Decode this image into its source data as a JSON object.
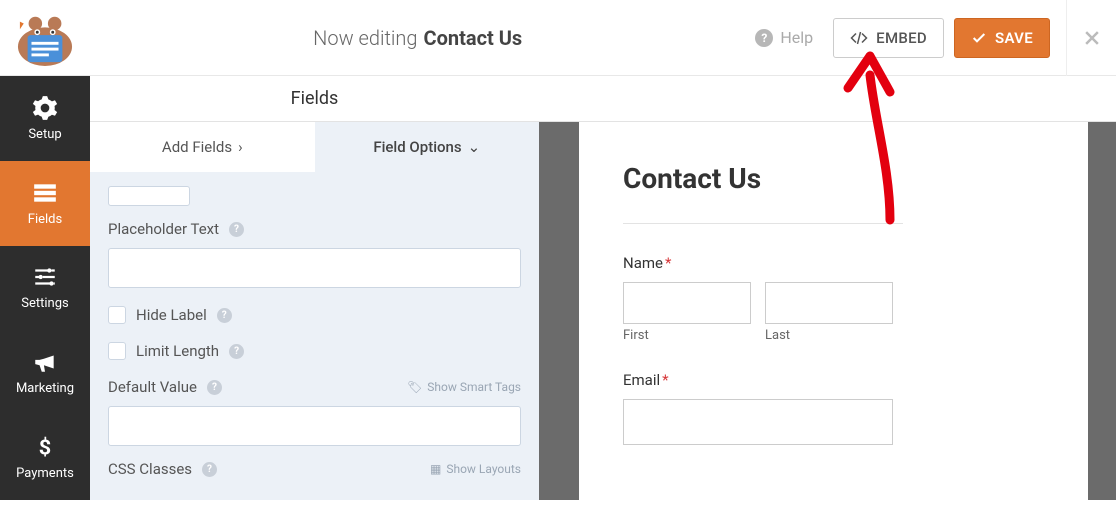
{
  "topbar": {
    "editing_prefix": "Now editing",
    "form_name": "Contact Us",
    "help": "Help",
    "embed": "EMBED",
    "save": "SAVE"
  },
  "sidebar": {
    "items": [
      {
        "label": "Setup"
      },
      {
        "label": "Fields"
      },
      {
        "label": "Settings"
      },
      {
        "label": "Marketing"
      },
      {
        "label": "Payments"
      }
    ]
  },
  "panel": {
    "title": "Fields",
    "tabs": {
      "add": "Add Fields",
      "options": "Field Options"
    },
    "placeholder_label": "Placeholder Text",
    "hide_label": "Hide Label",
    "limit_length": "Limit Length",
    "default_value": "Default Value",
    "smart_tags": "Show Smart Tags",
    "css_classes": "CSS Classes",
    "show_layouts": "Show Layouts"
  },
  "preview": {
    "title": "Contact Us",
    "name_label": "Name",
    "first": "First",
    "last": "Last",
    "email_label": "Email"
  }
}
